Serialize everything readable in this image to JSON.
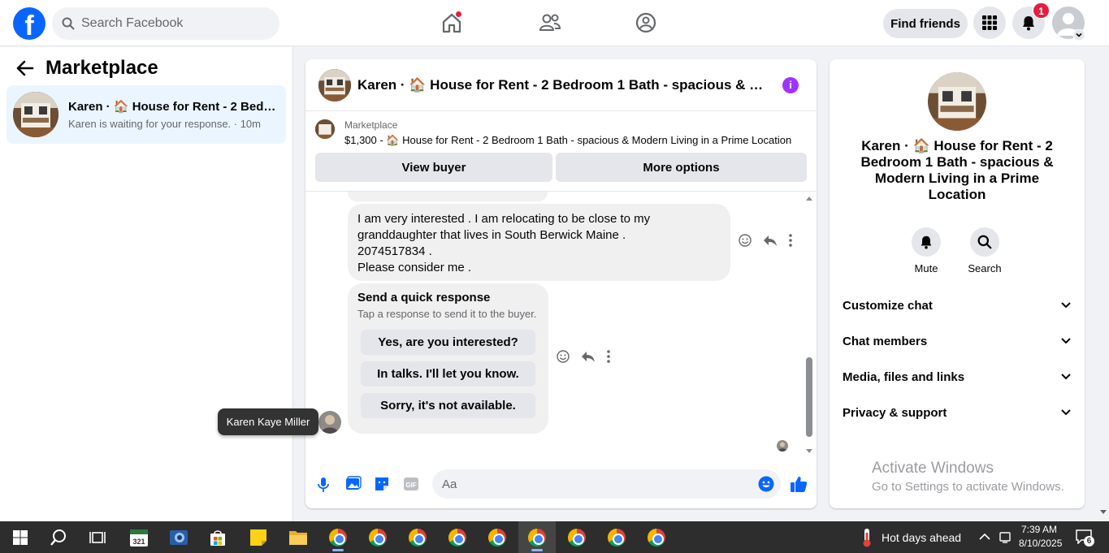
{
  "topbar": {
    "logo": "f",
    "search_placeholder": "Search Facebook",
    "find_friends": "Find friends",
    "notification_count": "1"
  },
  "left": {
    "title": "Marketplace",
    "conversation": {
      "title": "Karen · 🏠 House for Rent - 2 Bedr...",
      "subtitle": "Karen is waiting for your response. · 10m"
    }
  },
  "chat": {
    "title": "Karen · 🏠 House for Rent - 2 Bedroom 1 Bath - spacious & Mod...",
    "listing_label": "Marketplace",
    "listing_text": "$1,300 - 🏠 House for Rent - 2 Bedroom 1 Bath - spacious & Modern Living in a Prime Location",
    "view_buyer": "View buyer",
    "more_options": "More options",
    "message_lines": [
      "I am very interested . I am relocating to be close to my",
      "granddaughter that lives in South Berwick Maine .",
      "2074517834 .",
      "Please consider me ."
    ],
    "quick_response_title": "Send a quick response",
    "quick_response_subtitle": "Tap a response to send it to the buyer.",
    "quick_responses": [
      "Yes, are you interested?",
      "In talks. I'll let you know.",
      "Sorry, it's not available."
    ],
    "tooltip": "Karen Kaye Miller",
    "composer_placeholder": "Aa"
  },
  "details": {
    "name": "Karen · 🏠 House for Rent - 2 Bedroom 1 Bath - spacious & Modern Living in a Prime Location",
    "mute": "Mute",
    "search": "Search",
    "sections": [
      "Customize chat",
      "Chat members",
      "Media, files and links",
      "Privacy & support"
    ],
    "watermark_title": "Activate Windows",
    "watermark_sub": "Go to Settings to activate Windows."
  },
  "taskbar": {
    "weather": "Hot days ahead",
    "time": "7:39 AM",
    "date": "8/10/2025",
    "notif_count": "6",
    "calendar_day": "321"
  },
  "colors": {
    "brand": "#0866ff",
    "accent_purple": "#a033ff",
    "badge_red": "#e41e3f"
  }
}
